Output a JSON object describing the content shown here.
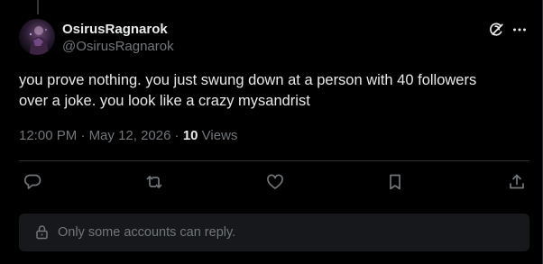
{
  "author": {
    "display_name": "OsirusRagnarok",
    "handle": "@OsirusRagnarok",
    "avatar_alt": "avatar"
  },
  "tweet": {
    "text": "you prove nothing. you just swung down at a person with 40 followers\nover a joke. you look like a crazy mysandrist",
    "time": "12:00 PM",
    "date": "May 12, 2026",
    "separator": "·",
    "views_count": "10",
    "views_label": "Views"
  },
  "actions": {
    "reply": "reply-icon",
    "repost": "repost-icon",
    "like": "heart-icon",
    "bookmark": "bookmark-icon",
    "share": "share-icon"
  },
  "header_icons": [
    "grok-icon",
    "more-icon"
  ],
  "reply_restriction": {
    "text": "Only some accounts can reply."
  },
  "colors": {
    "background": "#000000",
    "text_primary": "#e7e9ea",
    "text_secondary": "#71767b",
    "border": "#2f3336",
    "restriction_bg": "#16181c"
  }
}
